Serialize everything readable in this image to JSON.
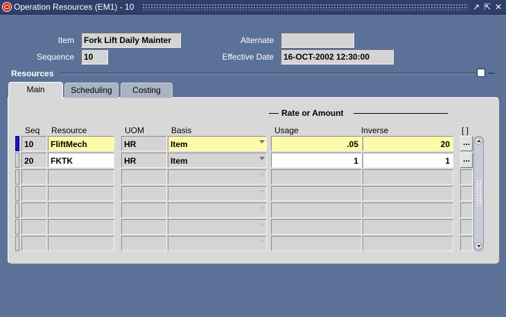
{
  "window": {
    "title": "Operation Resources (EM1) - 10",
    "controls": [
      "minimize-icon",
      "maximize-icon",
      "close-icon"
    ]
  },
  "header": {
    "item_label": "Item",
    "item_value": "Fork Lift Daily Mainter",
    "sequence_label": "Sequence",
    "sequence_value": "10",
    "alternate_label": "Alternate",
    "alternate_value": "",
    "effective_date_label": "Effective Date",
    "effective_date_value": "16-OCT-2002 12:30:00"
  },
  "section": {
    "title": "Resources"
  },
  "tabs": [
    {
      "label": "Main",
      "active": true
    },
    {
      "label": "Scheduling",
      "active": false
    },
    {
      "label": "Costing",
      "active": false
    }
  ],
  "table": {
    "group_header": "Rate or Amount",
    "columns": {
      "seq": "Seq",
      "resource": "Resource",
      "uom": "UOM",
      "basis": "Basis",
      "usage": "Usage",
      "inverse": "Inverse",
      "flex": "[ ]"
    },
    "rows": [
      {
        "seq": "10",
        "resource": "FliftMech",
        "uom": "HR",
        "basis": "Item",
        "usage": ".05",
        "inverse": "20",
        "more": "..."
      },
      {
        "seq": "20",
        "resource": "FKTK",
        "uom": "HR",
        "basis": "Item",
        "usage": "1",
        "inverse": "1",
        "more": "..."
      },
      {
        "seq": "",
        "resource": "",
        "uom": "",
        "basis": "",
        "usage": "",
        "inverse": "",
        "more": ""
      },
      {
        "seq": "",
        "resource": "",
        "uom": "",
        "basis": "",
        "usage": "",
        "inverse": "",
        "more": ""
      },
      {
        "seq": "",
        "resource": "",
        "uom": "",
        "basis": "",
        "usage": "",
        "inverse": "",
        "more": ""
      },
      {
        "seq": "",
        "resource": "",
        "uom": "",
        "basis": "",
        "usage": "",
        "inverse": "",
        "more": ""
      },
      {
        "seq": "",
        "resource": "",
        "uom": "",
        "basis": "",
        "usage": "",
        "inverse": "",
        "more": ""
      }
    ]
  },
  "colors": {
    "background": "#5c7197",
    "title_bar": "#2f3f6a",
    "required_field": "#fffaa8",
    "current_record": "#1818b8"
  }
}
